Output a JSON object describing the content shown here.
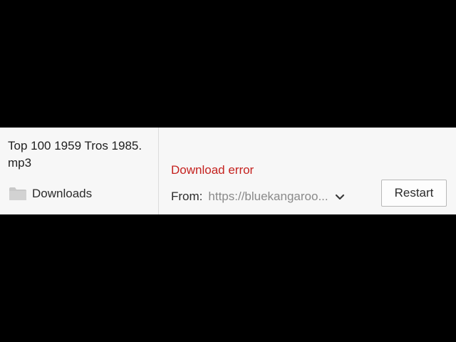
{
  "download": {
    "file_name": "Top 100 1959 Tros 1985.mp3",
    "folder_label": "Downloads",
    "folder_icon": "folder-icon",
    "status": "Download error",
    "from_label": "From:",
    "from_url": "https://bluekangaroo...",
    "expand_icon": "chevron-down-icon",
    "restart_label": "Restart"
  },
  "colors": {
    "error": "#c5221f",
    "background": "#f7f7f7",
    "url": "#8a8a8a"
  }
}
